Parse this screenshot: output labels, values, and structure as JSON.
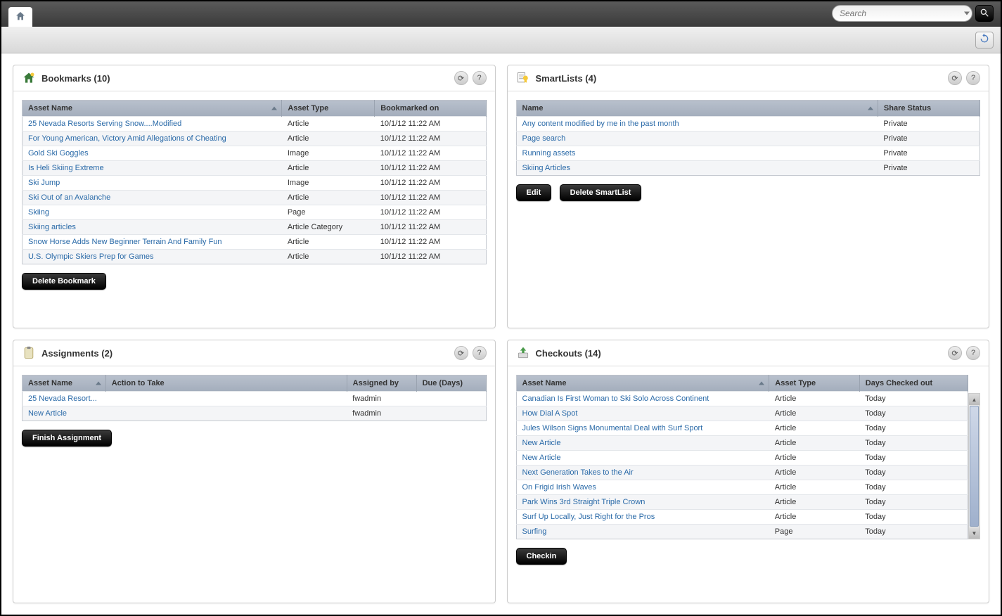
{
  "topbar": {
    "search_placeholder": "Search"
  },
  "panels": {
    "bookmarks": {
      "title": "Bookmarks (10)",
      "columns": [
        "Asset Name",
        "Asset Type",
        "Bookmarked on"
      ],
      "rows": [
        {
          "name": "25 Nevada Resorts Serving Snow....Modified",
          "type": "Article",
          "date": "10/1/12 11:22 AM"
        },
        {
          "name": "For Young American, Victory Amid Allegations of Cheating",
          "type": "Article",
          "date": "10/1/12 11:22 AM"
        },
        {
          "name": "Gold Ski Goggles",
          "type": "Image",
          "date": "10/1/12 11:22 AM"
        },
        {
          "name": "Is Heli Skiing Extreme",
          "type": "Article",
          "date": "10/1/12 11:22 AM"
        },
        {
          "name": "Ski Jump",
          "type": "Image",
          "date": "10/1/12 11:22 AM"
        },
        {
          "name": "Ski Out of an Avalanche",
          "type": "Article",
          "date": "10/1/12 11:22 AM"
        },
        {
          "name": "Skiing",
          "type": "Page",
          "date": "10/1/12 11:22 AM"
        },
        {
          "name": "Skiing articles",
          "type": "Article Category",
          "date": "10/1/12 11:22 AM"
        },
        {
          "name": "Snow Horse Adds New Beginner Terrain And Family Fun",
          "type": "Article",
          "date": "10/1/12 11:22 AM"
        },
        {
          "name": "U.S. Olympic Skiers Prep for Games",
          "type": "Article",
          "date": "10/1/12 11:22 AM"
        }
      ],
      "delete_label": "Delete Bookmark"
    },
    "smartlists": {
      "title": "SmartLists (4)",
      "columns": [
        "Name",
        "Share Status"
      ],
      "rows": [
        {
          "name": "Any content modified by me in the past month",
          "status": "Private"
        },
        {
          "name": "Page search",
          "status": "Private"
        },
        {
          "name": "Running assets",
          "status": "Private"
        },
        {
          "name": "Skiing Articles",
          "status": "Private"
        }
      ],
      "edit_label": "Edit",
      "delete_label": "Delete SmartList"
    },
    "assignments": {
      "title": "Assignments (2)",
      "columns": [
        "Asset Name",
        "Action to Take",
        "Assigned by",
        "Due (Days)"
      ],
      "rows": [
        {
          "name": "25 Nevada Resort...",
          "action": "",
          "by": "fwadmin",
          "due": ""
        },
        {
          "name": "New Article",
          "action": "",
          "by": "fwadmin",
          "due": ""
        }
      ],
      "finish_label": "Finish Assignment"
    },
    "checkouts": {
      "title": "Checkouts (14)",
      "columns": [
        "Asset Name",
        "Asset Type",
        "Days Checked out"
      ],
      "rows": [
        {
          "name": "Canadian Is First Woman to Ski Solo Across Continent",
          "type": "Article",
          "days": "Today"
        },
        {
          "name": "How Dial A Spot",
          "type": "Article",
          "days": "Today"
        },
        {
          "name": "Jules Wilson Signs Monumental Deal with Surf Sport",
          "type": "Article",
          "days": "Today"
        },
        {
          "name": "New Article",
          "type": "Article",
          "days": "Today"
        },
        {
          "name": "New Article",
          "type": "Article",
          "days": "Today"
        },
        {
          "name": "Next Generation Takes to the Air",
          "type": "Article",
          "days": "Today"
        },
        {
          "name": "On Frigid Irish Waves",
          "type": "Article",
          "days": "Today"
        },
        {
          "name": "Park Wins 3rd Straight Triple Crown",
          "type": "Article",
          "days": "Today"
        },
        {
          "name": "Surf Up Locally, Just Right for the Pros",
          "type": "Article",
          "days": "Today"
        },
        {
          "name": "Surfing",
          "type": "Page",
          "days": "Today"
        }
      ],
      "checkin_label": "Checkin"
    }
  }
}
